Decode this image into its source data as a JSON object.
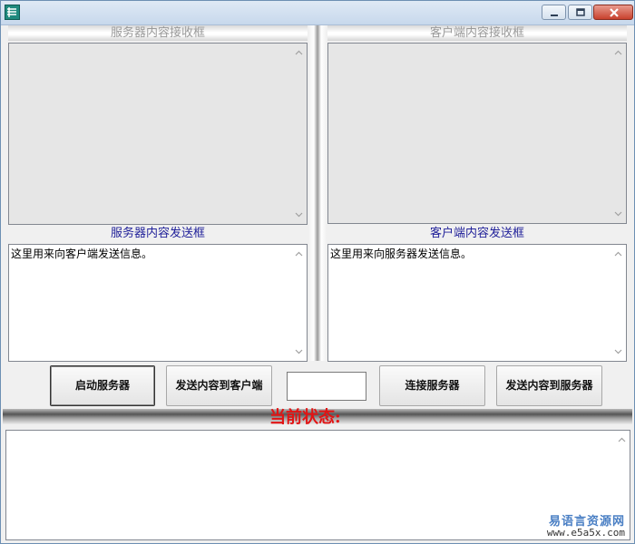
{
  "window": {
    "title": "",
    "controls": [
      "minimize-icon",
      "maximize-icon",
      "close-icon"
    ]
  },
  "server": {
    "receive_header": "服务器内容接收框",
    "receive_content": "",
    "send_label": "服务器内容发送框",
    "send_content": "这里用来向客户端发送信息。"
  },
  "client": {
    "receive_header": "客户端内容接收框",
    "receive_content": "",
    "send_label": "客户端内容发送框",
    "send_content": "这里用来向服务器发送信息。"
  },
  "buttons": {
    "start_server": "启动服务器",
    "send_to_client": "发送内容到客户端",
    "connect_server": "连接服务器",
    "send_to_server": "发送内容到服务器"
  },
  "port_input": {
    "value": ""
  },
  "status": {
    "label": "当前状态:",
    "log": ""
  },
  "watermark": {
    "name": "易语言资源网",
    "url": "www.e5a5x.com"
  },
  "colors": {
    "status_red": "#e11414",
    "send_label_blue": "#1f1f99",
    "header_gray": "#9a9a9a"
  }
}
